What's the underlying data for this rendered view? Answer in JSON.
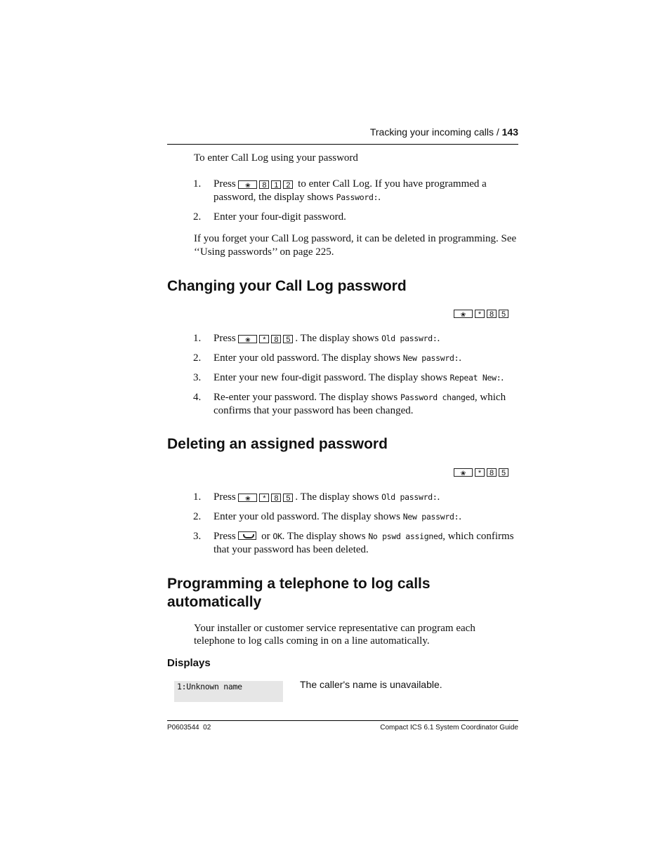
{
  "header": {
    "section": "Tracking your incoming calls /",
    "page_number": "143"
  },
  "intro": {
    "title": "To enter Call Log using your password",
    "steps": [
      {
        "num": "1.",
        "pre": "Press",
        "keys": [
          "feature",
          "8",
          "1",
          "2"
        ],
        "text": "to enter Call Log. If you have programmed a password, the display shows",
        "display": "Password:",
        "post": "."
      },
      {
        "num": "2.",
        "text": "Enter your four-digit password."
      }
    ],
    "note": "If you forget your Call Log password, it can be deleted in programming. See ‘‘Using passwords’’ on page 225."
  },
  "section_change": {
    "heading": "Changing your Call Log password",
    "keys": [
      "feature",
      "*",
      "8",
      "5"
    ],
    "steps": [
      {
        "num": "1.",
        "pre": "Press",
        "keys": [
          "feature",
          "*",
          "8",
          "5"
        ],
        "text": ". The display shows",
        "display": "Old passwrd:",
        "post": "."
      },
      {
        "num": "2.",
        "text": "Enter your old password. The display shows",
        "display": "New passwrd:",
        "post": "."
      },
      {
        "num": "3.",
        "text": "Enter your new four-digit password. The display shows",
        "display": "Repeat New:",
        "post": "."
      },
      {
        "num": "4.",
        "text": "Re-enter your password. The display shows",
        "display": "Password changed",
        "post": ", which confirms that your password has been changed."
      }
    ]
  },
  "section_delete": {
    "heading": "Deleting an assigned password",
    "keys": [
      "feature",
      "*",
      "8",
      "5"
    ],
    "steps": [
      {
        "num": "1.",
        "pre": "Press",
        "keys": [
          "feature",
          "*",
          "8",
          "5"
        ],
        "text": ". The display shows",
        "display": "Old passwrd:",
        "post": "."
      },
      {
        "num": "2.",
        "text": "Enter your old password. The display shows",
        "display": "New passwrd:",
        "post": "."
      },
      {
        "num": "3.",
        "pre": "Press",
        "key_icon": "handsfree-key",
        "or": "or",
        "ok": "OK",
        "text": ". The display shows",
        "display": "No pswd assigned",
        "post": ", which confirms that your password has been deleted."
      }
    ]
  },
  "section_auto": {
    "heading": "Programming a telephone to log calls automatically",
    "paragraph": "Your installer or customer service representative can program each telephone to log calls coming in on a line automatically.",
    "subheading": "Displays",
    "displays": [
      {
        "lcd": "1:Unknown name",
        "description": "The caller's name is unavailable."
      }
    ]
  },
  "footer": {
    "left": "P0603544  02",
    "right": "Compact ICS 6.1 System Coordinator Guide"
  }
}
